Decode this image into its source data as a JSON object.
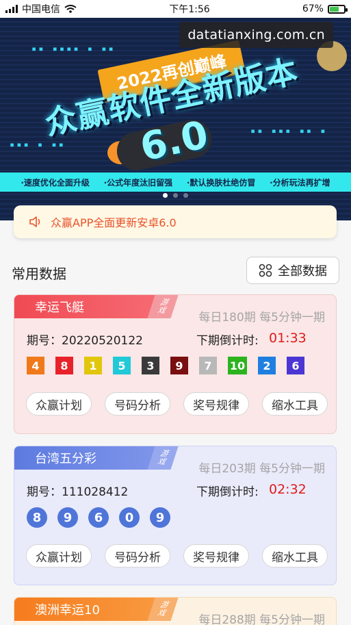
{
  "status_bar": {
    "carrier": "中国电信",
    "time": "下午1:56",
    "battery_percent": "67%",
    "battery_level": 0.67
  },
  "banner": {
    "watermark": "datatianxing.com.cn",
    "ribbon": "2022再创巅峰",
    "headline": "众赢软件全新版本",
    "version": "6.0",
    "features": [
      "·速度优化全面升级",
      "·公式年度汰旧留强",
      "·默认换肤杜绝仿冒",
      "·分析玩法再扩增"
    ],
    "carousel_active_index": 0,
    "carousel_count": 3
  },
  "notice": {
    "icon": "speaker-icon",
    "text": "众赢APP全面更新安卓6.0"
  },
  "section": {
    "title": "常用数据",
    "all_button_label": "全部数据",
    "all_button_icon": "grid-icon"
  },
  "cards": [
    {
      "name": "幸运飞艇",
      "game_tag": [
        "游",
        "戏"
      ],
      "meta": "每日180期 每5分钟一期",
      "issue": "期号：20220520122",
      "countdown_label": "下期倒计时:",
      "countdown": "01:33",
      "balls": [
        {
          "n": "4",
          "color": "#f07a1a"
        },
        {
          "n": "8",
          "color": "#e8222a"
        },
        {
          "n": "1",
          "color": "#e2c60c"
        },
        {
          "n": "5",
          "color": "#22c9d8"
        },
        {
          "n": "3",
          "color": "#3a3a3a"
        },
        {
          "n": "9",
          "color": "#7a0f10"
        },
        {
          "n": "7",
          "color": "#b8b8b8"
        },
        {
          "n": "10",
          "color": "#2cb31e"
        },
        {
          "n": "2",
          "color": "#1f7fe0"
        },
        {
          "n": "6",
          "color": "#4b36d4"
        }
      ],
      "actions": [
        "众赢计划",
        "号码分析",
        "奖号规律",
        "缩水工具"
      ],
      "accent": "#f04a53"
    },
    {
      "name": "台湾五分彩",
      "game_tag": [
        "游",
        "戏"
      ],
      "meta": "每日203期 每5分钟一期",
      "issue": "期号：111028412",
      "countdown_label": "下期倒计时:",
      "countdown": "02:32",
      "balls": [
        "8",
        "9",
        "6",
        "0",
        "9"
      ],
      "actions": [
        "众赢计划",
        "号码分析",
        "奖号规律",
        "缩水工具"
      ],
      "accent": "#5d7be0"
    },
    {
      "name": "澳洲幸运10",
      "game_tag": [
        "游",
        "戏"
      ],
      "meta": "每日288期 每5分钟一期",
      "accent": "#f67c1e"
    }
  ]
}
